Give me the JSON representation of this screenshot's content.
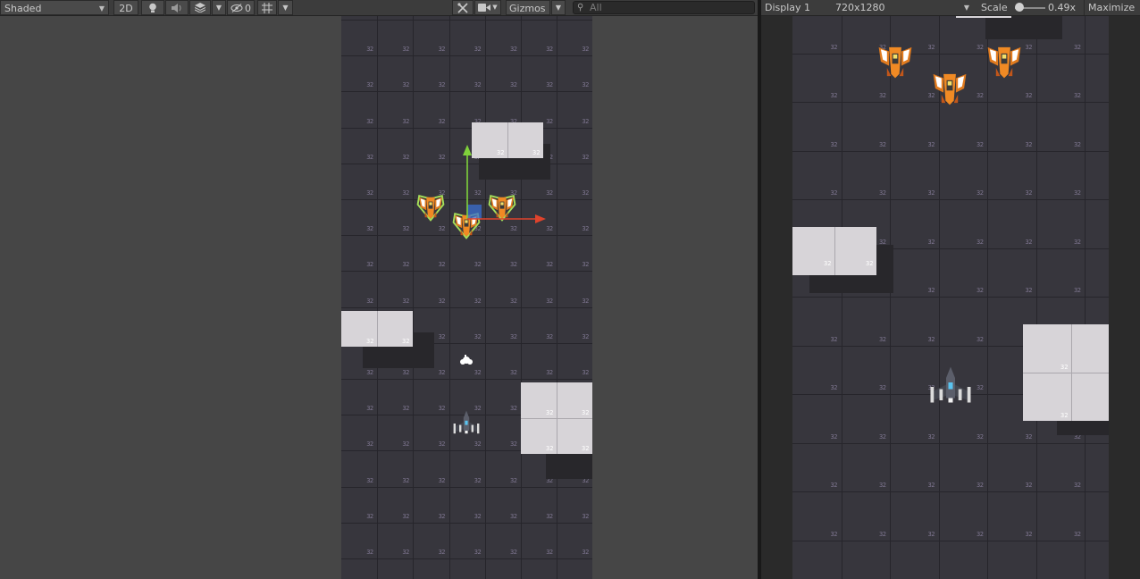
{
  "scene_toolbar": {
    "shading_mode": "Shaded",
    "mode_2d": "2D",
    "hidden_count": "0",
    "gizmos_label": "Gizmos",
    "search_placeholder": "All"
  },
  "game_toolbar": {
    "display": "Display 1",
    "resolution": "720x1280",
    "scale_label": "Scale",
    "scale_value": "0.49x",
    "maximize_label": "Maximize",
    "scale_fraction": 0.15
  },
  "tile_label": "32",
  "colors": {
    "board": "#37363d",
    "grid": "#26252b",
    "block": "#d7d4d8",
    "gizmo_x": "#e0432c",
    "gizmo_y": "#7fd13b",
    "gizmo_plane": "#3b6fd1"
  },
  "icons": [
    "lightbulb-icon",
    "speaker-icon",
    "layers-icon",
    "eye-hidden-icon",
    "grid-snap-icon",
    "tools-icon",
    "camera-icon",
    "search-icon"
  ]
}
